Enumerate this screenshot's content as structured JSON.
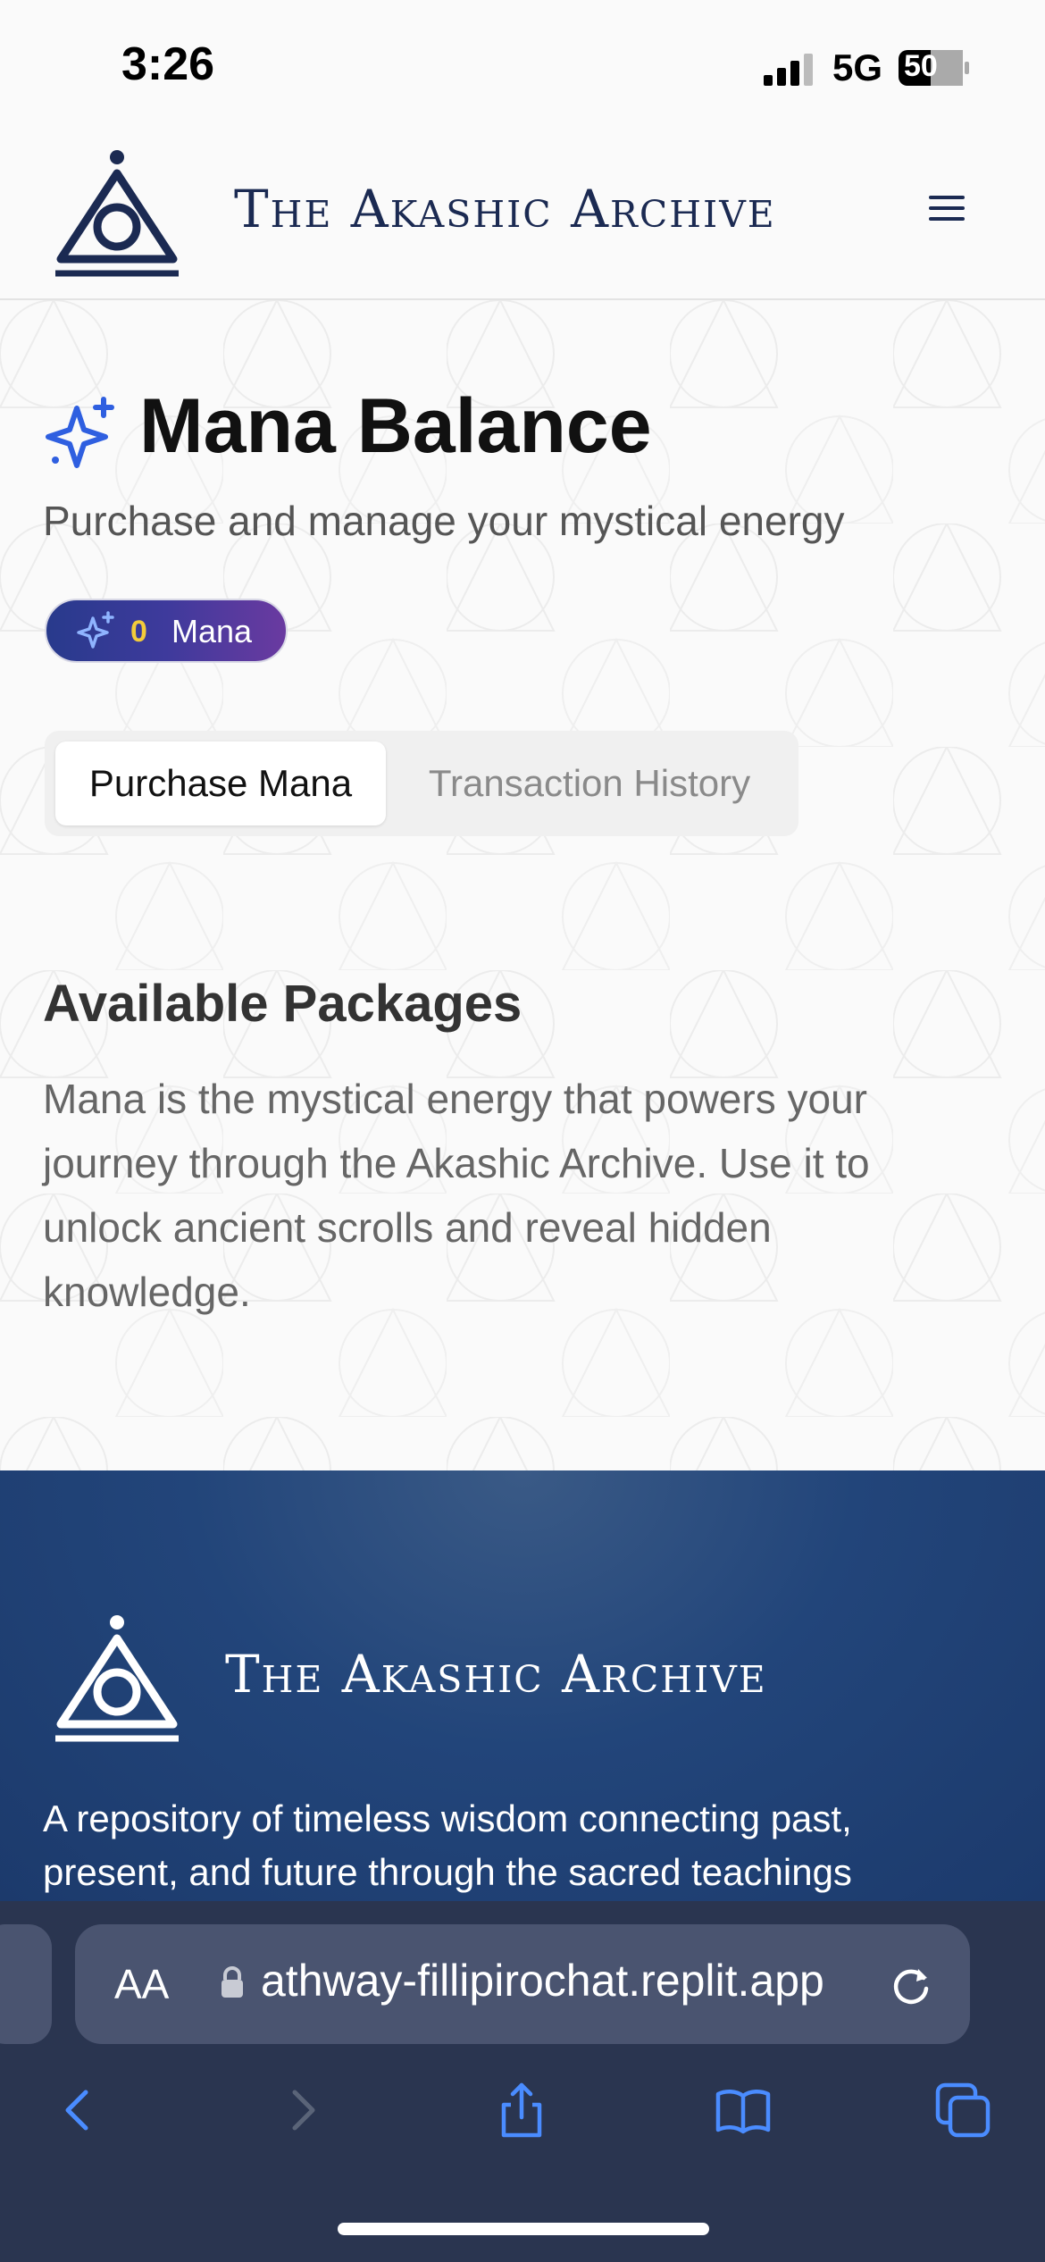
{
  "status": {
    "time": "3:26",
    "network": "5G",
    "battery": "50"
  },
  "header": {
    "brand": "The Akashic Archive",
    "menu_icon": "hamburger-menu-icon",
    "logo_icon": "eye-triangle-logo-icon"
  },
  "main": {
    "title": "Mana Balance",
    "title_icon": "sparkles-icon",
    "subtitle": "Purchase and manage your mystical energy",
    "mana_badge": {
      "count": "0",
      "label": "Mana"
    },
    "tabs": [
      {
        "label": "Purchase Mana",
        "active": true
      },
      {
        "label": "Transaction History",
        "active": false
      }
    ],
    "section_title": "Available Packages",
    "section_text": "Mana is the mystical energy that powers your journey through the Akashic Archive. Use it to unlock ancient scrolls and reveal hidden knowledge."
  },
  "footer": {
    "brand": "The Akashic Archive",
    "description": "A repository of timeless wisdom connecting past, present, and future through the sacred teachings"
  },
  "browser": {
    "text_size_label": "AA",
    "url": "athway-fillipirochat.replit.app",
    "nav": [
      "back-icon",
      "forward-icon",
      "share-icon",
      "bookmarks-icon",
      "tabs-icon"
    ]
  },
  "colors": {
    "brand_navy": "#1b2a52",
    "accent_blue": "#2f5fe0",
    "badge_gradient_start": "#283a8c",
    "badge_gradient_end": "#6a3aa0",
    "badge_count": "#f3cb3a",
    "footer_bg": "#1c3a6c",
    "browser_bg": "#2a3550",
    "browser_accent": "#4a8cff"
  }
}
